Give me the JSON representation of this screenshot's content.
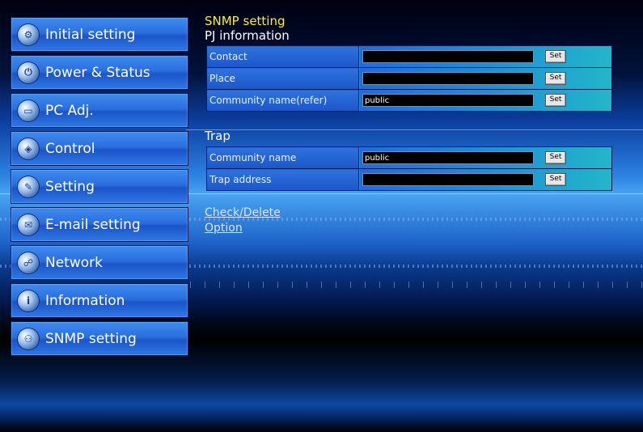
{
  "sidebar": {
    "items": [
      {
        "label": "Initial setting",
        "icon": "gear-icon"
      },
      {
        "label": "Power & Status",
        "icon": "power-icon"
      },
      {
        "label": "PC Adj.",
        "icon": "monitor-icon"
      },
      {
        "label": "Control",
        "icon": "control-icon"
      },
      {
        "label": "Setting",
        "icon": "wrench-icon"
      },
      {
        "label": "E-mail setting",
        "icon": "mail-icon"
      },
      {
        "label": "Network",
        "icon": "network-icon"
      },
      {
        "label": "Information",
        "icon": "info-icon"
      },
      {
        "label": "SNMP setting",
        "icon": "snmp-icon"
      }
    ]
  },
  "main": {
    "page_title": "SNMP setting",
    "pj_info": {
      "title": "PJ information",
      "rows": [
        {
          "label": "Contact",
          "value": "",
          "button": "Set"
        },
        {
          "label": "Place",
          "value": "",
          "button": "Set"
        },
        {
          "label": "Community name(refer)",
          "value": "public",
          "button": "Set"
        }
      ]
    },
    "trap": {
      "title": "Trap",
      "rows": [
        {
          "label": "Community name",
          "value": "public",
          "button": "Set"
        },
        {
          "label": "Trap address",
          "value": "",
          "button": "Set"
        }
      ]
    },
    "links": {
      "check_delete": "Check/Delete",
      "option": "Option"
    }
  },
  "colors": {
    "title_yellow": "#ffef1a",
    "nav_blue": "#2a6ede",
    "field_bg": "#000000"
  }
}
